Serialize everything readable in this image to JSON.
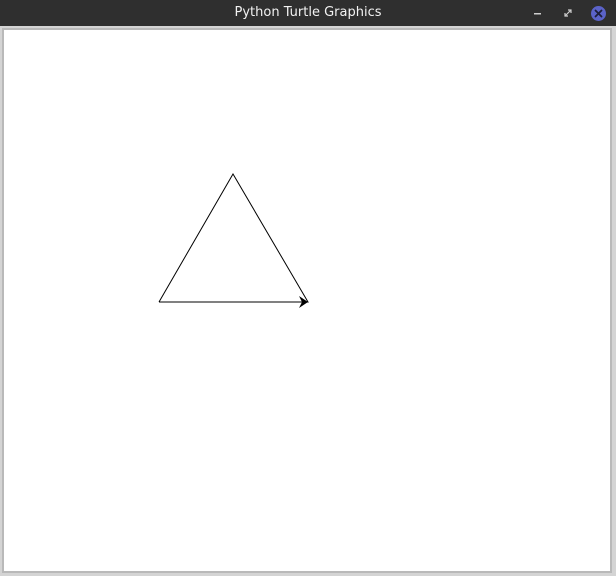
{
  "window": {
    "title": "Python Turtle Graphics",
    "titlebar_color": "#2f2f2f",
    "close_button_color": "#5b63c9"
  },
  "canvas": {
    "background": "#ffffff",
    "pen_color": "#000000",
    "shape": "triangle",
    "turtle_heading": "east"
  },
  "icons": {
    "minimize": "minimize-icon",
    "restore": "restore-icon",
    "close": "close-icon",
    "turtle": "turtle-arrow-icon"
  }
}
